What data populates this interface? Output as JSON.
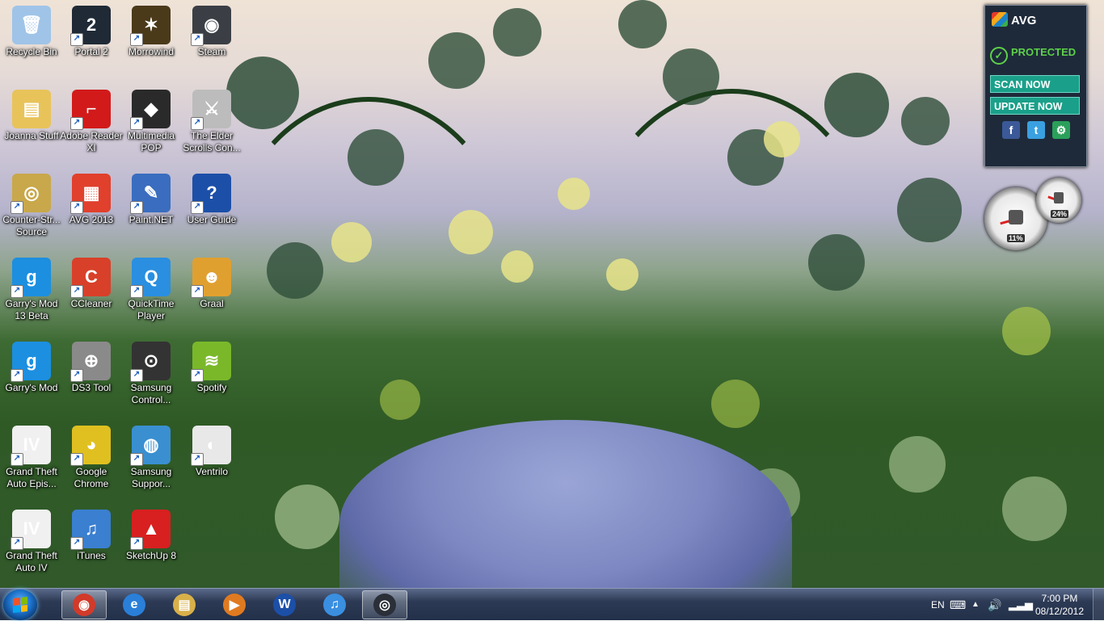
{
  "desktop": {
    "icons": [
      {
        "label": "Recycle Bin",
        "icon": "recycle-bin-icon",
        "color": "#9fc4e8"
      },
      {
        "label": "Portal 2",
        "icon": "portal2-icon",
        "color": "#1f2a36"
      },
      {
        "label": "Morrowind",
        "icon": "morrowind-icon",
        "color": "#4a3a1a"
      },
      {
        "label": "Steam",
        "icon": "steam-icon",
        "color": "#3b3f45"
      },
      {
        "label": "Joanna Stuff",
        "icon": "folder-icon",
        "color": "#e8c35a"
      },
      {
        "label": "Adobe Reader XI",
        "icon": "adobe-reader-icon",
        "color": "#d21a1a"
      },
      {
        "label": "Multimedia POP",
        "icon": "multimedia-pop-icon",
        "color": "#2a2a2a"
      },
      {
        "label": "The Elder Scrolls Con...",
        "icon": "elder-scrolls-icon",
        "color": "#bcbcbc"
      },
      {
        "label": "Counter-Str... Source",
        "icon": "counter-strike-icon",
        "color": "#c8a84a"
      },
      {
        "label": "AVG 2013",
        "icon": "avg-icon",
        "color": "#e0402c"
      },
      {
        "label": "Paint.NET",
        "icon": "paint-net-icon",
        "color": "#3a6dbf"
      },
      {
        "label": "User Guide",
        "icon": "user-guide-icon",
        "color": "#1c4fa8"
      },
      {
        "label": "Garry's Mod 13 Beta",
        "icon": "garrys-mod-icon",
        "color": "#1c8fe0"
      },
      {
        "label": "CCleaner",
        "icon": "ccleaner-icon",
        "color": "#d8402a"
      },
      {
        "label": "QuickTime Player",
        "icon": "quicktime-icon",
        "color": "#2a8fe0"
      },
      {
        "label": "Graal",
        "icon": "graal-icon",
        "color": "#e0a030"
      },
      {
        "label": "Garry's Mod",
        "icon": "garrys-mod-icon",
        "color": "#1c8fe0"
      },
      {
        "label": "DS3 Tool",
        "icon": "gamepad-icon",
        "color": "#8a8a8a"
      },
      {
        "label": "Samsung Control...",
        "icon": "samsung-control-icon",
        "color": "#333333"
      },
      {
        "label": "Spotify",
        "icon": "spotify-icon",
        "color": "#7ab82a"
      },
      {
        "label": "Grand Theft Auto Epis...",
        "icon": "gta-icon",
        "color": "#f0f0f0"
      },
      {
        "label": "Google Chrome",
        "icon": "chrome-icon",
        "color": "#e0c020"
      },
      {
        "label": "Samsung Suppor...",
        "icon": "samsung-support-icon",
        "color": "#3a8fd0"
      },
      {
        "label": "Ventrilo",
        "icon": "ventrilo-icon",
        "color": "#e8e8e8"
      },
      {
        "label": "Grand Theft Auto IV",
        "icon": "gta-icon",
        "color": "#f0f0f0"
      },
      {
        "label": "iTunes",
        "icon": "itunes-icon",
        "color": "#3a7fd0"
      },
      {
        "label": "SketchUp 8",
        "icon": "sketchup-icon",
        "color": "#d82020"
      }
    ],
    "glyphs": [
      "🗑",
      "2",
      "✶",
      "◉",
      "▤",
      "⌐",
      "◆",
      "⚔",
      "◎",
      "▦",
      "✎",
      "?",
      "g",
      "C",
      "Q",
      "☻",
      "g",
      "⊕",
      "⊙",
      "≋",
      "IV",
      "◕",
      "◍",
      "◐",
      "IV",
      "♫",
      "▲"
    ]
  },
  "avg_gadget": {
    "brand": "AVG",
    "status": "PROTECTED",
    "scan_label": "SCAN NOW",
    "update_label": "UPDATE NOW",
    "social": [
      "f",
      "t",
      "⚙"
    ]
  },
  "meter_gadget": {
    "cpu_label": "11%",
    "mem_label": "24%",
    "cpu": 0.11,
    "mem": 0.24
  },
  "taskbar": {
    "pinned": [
      {
        "name": "chrome",
        "icon": "chrome-icon",
        "glyph": "◉",
        "color": "#d23a2a",
        "active": true
      },
      {
        "name": "internet-explorer",
        "icon": "internet-explorer-icon",
        "glyph": "e",
        "color": "#2a7fd8",
        "active": false
      },
      {
        "name": "windows-explorer",
        "icon": "folder-icon",
        "glyph": "▤",
        "color": "#d8b04a",
        "active": false
      },
      {
        "name": "media-player",
        "icon": "media-player-icon",
        "glyph": "▶",
        "color": "#e07a20",
        "active": false
      },
      {
        "name": "word",
        "icon": "word-icon",
        "glyph": "W",
        "color": "#1c4fa8",
        "active": false
      },
      {
        "name": "itunes",
        "icon": "itunes-icon",
        "glyph": "♫",
        "color": "#3a8fe0",
        "active": false
      },
      {
        "name": "steam",
        "icon": "steam-icon",
        "glyph": "◎",
        "color": "#2a2f38",
        "active": true
      }
    ],
    "language": "EN",
    "time": "7:00 PM",
    "date": "08/12/2012"
  }
}
